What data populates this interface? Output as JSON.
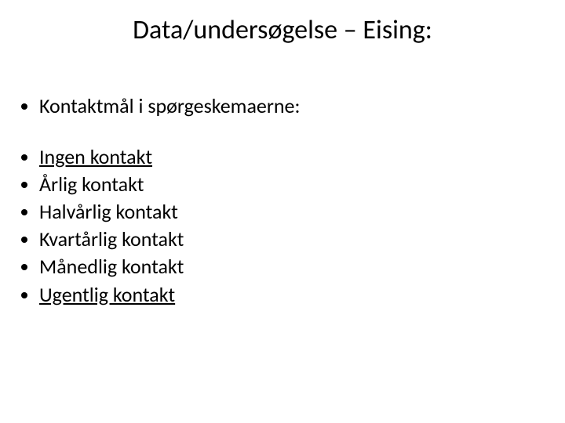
{
  "title": "Data/undersøgelse – Eising:",
  "intro": "Kontaktmål i spørgeskemaerne:",
  "items": [
    "Ingen kontakt",
    "Årlig kontakt",
    "Halvårlig kontakt",
    "Kvartårlig kontakt",
    "Månedlig kontakt",
    "Ugentlig kontakt"
  ]
}
